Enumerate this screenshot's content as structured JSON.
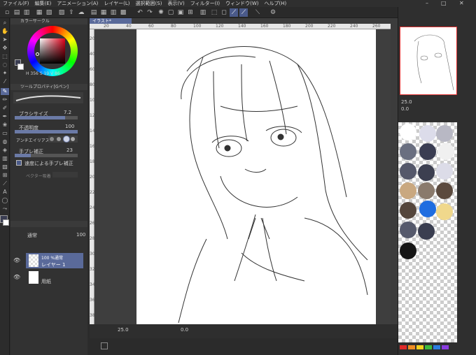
{
  "menu": [
    "ファイル(F)",
    "編集(E)",
    "アニメーション(A)",
    "レイヤー(L)",
    "選択範囲(S)",
    "表示(V)",
    "フィルター(I)",
    "ウィンドウ(W)",
    "ヘルプ(H)"
  ],
  "document_tab": "イラスト*",
  "color_circle": {
    "title": "カラーサークル",
    "hsv": "H 356 S 19 V 86"
  },
  "tool_property": {
    "title": "ツールプロパティ[Gペン]",
    "brush_size_label": "ブラシサイズ",
    "brush_size_value": "7.2",
    "opacity_label": "不透明度",
    "opacity_value": "100",
    "antialias_label": "アンチエイリアス",
    "stabilization_label": "手ブレ補正",
    "stabilization_value": "23",
    "speed_stabilization_label": "速度による手ブレ補正",
    "vector_label": "ベクター吸着"
  },
  "layer_panel": {
    "blend_mode": "通常",
    "opacity": "100",
    "layers": [
      {
        "info": "100 %通常",
        "name": "レイヤー 1"
      },
      {
        "info": "",
        "name": "用紙"
      }
    ]
  },
  "navigator": {
    "zoom": "25.0",
    "angle": "0.0"
  },
  "status": {
    "zoom": "25.0",
    "coords": "0.0"
  },
  "ruler_top": [
    "20",
    "40",
    "60",
    "80",
    "100",
    "120",
    "140",
    "160",
    "180",
    "200",
    "220",
    "240",
    "260"
  ],
  "ruler_left": [
    "20",
    "40",
    "60",
    "80",
    "100",
    "120",
    "140",
    "160",
    "180",
    "200",
    "220",
    "240",
    "260",
    "280",
    "300",
    "320",
    "340",
    "360",
    "380"
  ],
  "color_set_bar": [
    "#e02a2a",
    "#f08c22",
    "#f5d21e",
    "#3dbb3d",
    "#2b7de0",
    "#8a3de0"
  ],
  "colors": {
    "accent": "#5a6a9a",
    "swatches": [
      "#ffffff",
      "#dcdcea",
      "#b8b8c4",
      "#6a6f80",
      "#3a3d52",
      "#f0f0f0",
      "#55586a",
      "#3c3f50",
      "#dcdce8",
      "#c9a880",
      "#8a7a6c",
      "#5b4a3e",
      "#54463c",
      "#1f6de0",
      "#f0d88c",
      "#565a6c",
      "#3a3e50",
      "#151515"
    ]
  }
}
